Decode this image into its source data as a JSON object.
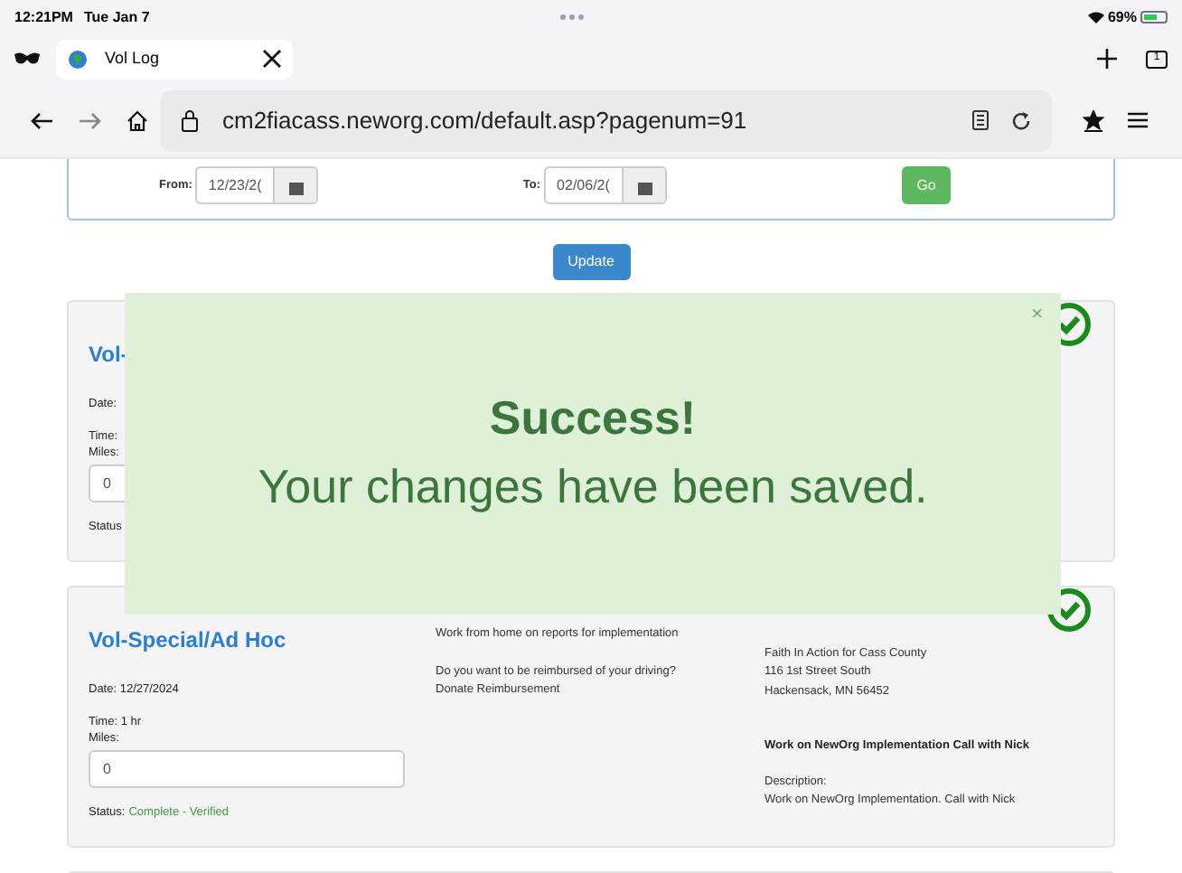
{
  "status_bar": {
    "time": "12:21PM",
    "date": "Tue Jan 7",
    "battery": "69%",
    "charging": true
  },
  "browser": {
    "tab": {
      "title": "Vol Log",
      "selected": true
    },
    "tab_count": "1",
    "url": "cm2fiacass.neworg.com/default.asp?pagenum=91"
  },
  "filter": {
    "from_label": "From:",
    "from_value": "12/23/2(",
    "to_label": "To:",
    "to_value": "02/06/2(",
    "go": "Go"
  },
  "update_button": "Update",
  "entries": [
    {
      "title": "Vol-",
      "date": "Date:",
      "time": "Time:",
      "miles_label": "Miles:",
      "miles_value": "0",
      "status_label": "Status",
      "verified": true
    },
    {
      "title": "Vol-Special/Ad Hoc",
      "date": "Date: 12/27/2024",
      "time": "Time: 1 hr",
      "miles_label": "Miles:",
      "miles_value": "0",
      "status_label": "Status:",
      "status_value": "Complete - Verified",
      "verified": true,
      "comment": "Work from home on reports for implementation",
      "reimburse_question": "Do you want to be reimbursed of your driving?",
      "reimburse_answer": "Donate Reimbursement",
      "location_lines": [
        "Faith In Action for Cass County",
        "116 1st Street South",
        "Hackensack, MN 56452"
      ],
      "activity": "Work on NewOrg Implementation Call with Nick",
      "description_label": "Description:",
      "description": "Work on NewOrg Implementation. Call with Nick"
    }
  ],
  "alert": {
    "heading": "Success!",
    "message": "Your changes have been saved.",
    "close": "×"
  }
}
